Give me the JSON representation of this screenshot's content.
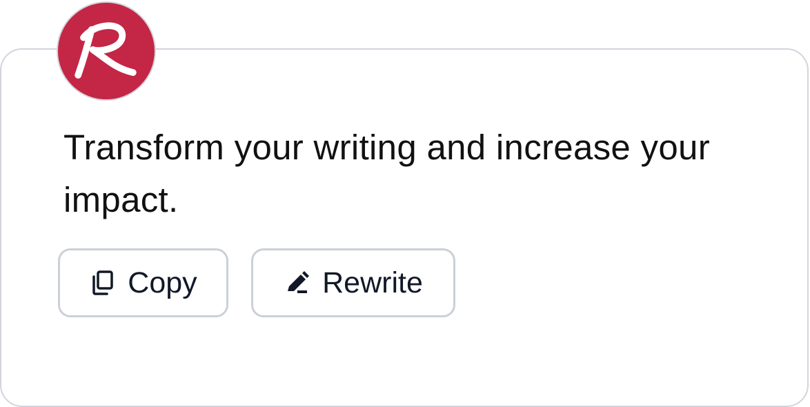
{
  "avatar": {
    "letter": "R",
    "color": "#c42645"
  },
  "message": {
    "text": "Transform your writing and increase your impact."
  },
  "actions": {
    "copy_label": "Copy",
    "copy_icon": "copy-icon",
    "rewrite_label": "Rewrite",
    "rewrite_icon": "pencil-icon"
  },
  "colors": {
    "border": "#d1d5db",
    "text": "#111111"
  }
}
